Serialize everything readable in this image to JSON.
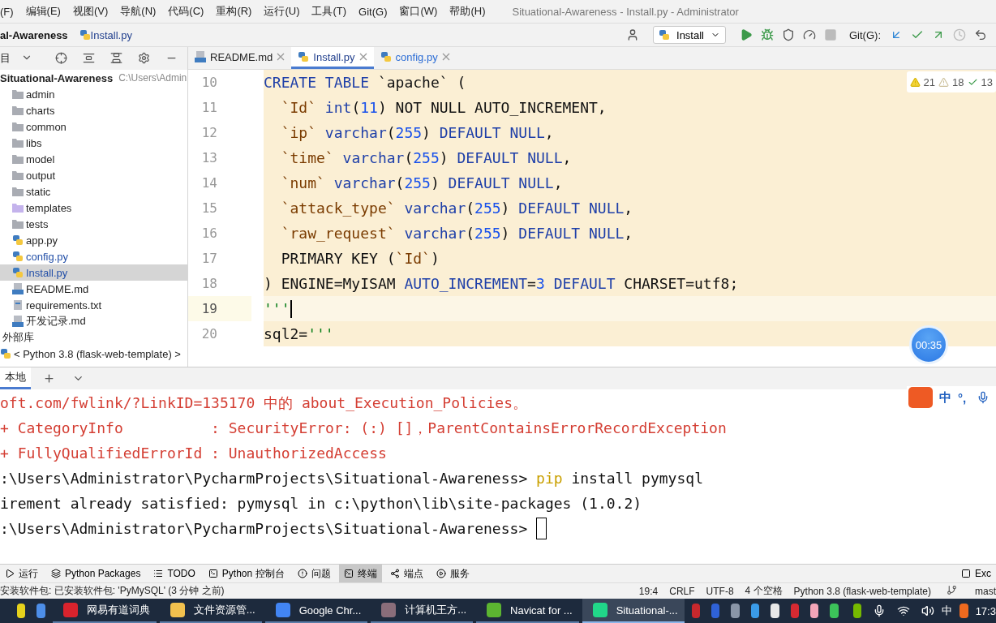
{
  "menu": [
    "(F)",
    "编辑(E)",
    "视图(V)",
    "导航(N)",
    "代码(C)",
    "重构(R)",
    "运行(U)",
    "工具(T)",
    "Git(G)",
    "窗口(W)",
    "帮助(H)"
  ],
  "window": {
    "title": "Situational-Awareness - Install.py - Administrator"
  },
  "breadcrumb": [
    "al-Awareness",
    "Install.py"
  ],
  "toolbar": {
    "run_config": "Install",
    "git_label": "Git(G):"
  },
  "project_panel": {
    "title": "目"
  },
  "tree": [
    {
      "label": "Situational-Awareness",
      "path": "C:\\Users\\Admin",
      "kind": "root",
      "selected": false,
      "children": [
        {
          "label": "admin",
          "kind": "folder",
          "selected": false,
          "modified": false
        },
        {
          "label": "charts",
          "kind": "folder",
          "selected": false,
          "modified": false
        },
        {
          "label": "common",
          "kind": "folder",
          "selected": false,
          "modified": false
        },
        {
          "label": "libs",
          "kind": "folder",
          "selected": false,
          "modified": false
        },
        {
          "label": "model",
          "kind": "folder",
          "selected": false,
          "modified": false
        },
        {
          "label": "output",
          "kind": "folder",
          "selected": false,
          "modified": false
        },
        {
          "label": "static",
          "kind": "folder",
          "selected": false,
          "modified": false
        },
        {
          "label": "templates",
          "kind": "template-folder",
          "selected": false,
          "modified": false
        },
        {
          "label": "tests",
          "kind": "folder",
          "selected": false,
          "modified": false
        },
        {
          "label": "app.py",
          "kind": "python",
          "selected": false,
          "modified": false
        },
        {
          "label": "config.py",
          "kind": "python",
          "selected": false,
          "modified": true
        },
        {
          "label": "Install.py",
          "kind": "python",
          "selected": true,
          "modified": true
        },
        {
          "label": "README.md",
          "kind": "markdown",
          "selected": false,
          "modified": false
        },
        {
          "label": "requirements.txt",
          "kind": "text",
          "selected": false,
          "modified": false
        },
        {
          "label": "开发记录.md",
          "kind": "markdown",
          "selected": false,
          "modified": false
        }
      ]
    },
    {
      "label": "外部库",
      "kind": "library",
      "selected": false,
      "children": [
        {
          "label": "< Python 3.8 (flask-web-template) >",
          "kind": "python",
          "selected": false,
          "modified": false
        }
      ]
    }
  ],
  "editor_tabs": [
    {
      "label": "README.md",
      "kind": "markdown",
      "selected": false,
      "modified": false
    },
    {
      "label": "Install.py",
      "kind": "python",
      "selected": true,
      "modified": true
    },
    {
      "label": "config.py",
      "kind": "python",
      "selected": false,
      "modified": true
    }
  ],
  "inspections": {
    "errors": "21",
    "warnings": "18",
    "typos": "13"
  },
  "code": [
    {
      "number": "10",
      "current": false,
      "tokens": [
        {
          "text": "CREATE TABLE ",
          "kind": "keyword"
        },
        {
          "text": "`apache`",
          "kind": "plain"
        },
        {
          "text": " (",
          "kind": "plain"
        }
      ]
    },
    {
      "number": "11",
      "current": false,
      "tokens": [
        {
          "text": "  `Id` ",
          "kind": "ident"
        },
        {
          "text": "int",
          "kind": "keyword"
        },
        {
          "text": "(",
          "kind": "plain"
        },
        {
          "text": "11",
          "kind": "number"
        },
        {
          "text": ") NOT NULL AUTO_INCREMENT,",
          "kind": "plain"
        }
      ]
    },
    {
      "number": "12",
      "current": false,
      "tokens": [
        {
          "text": "  `ip` ",
          "kind": "ident"
        },
        {
          "text": "varchar",
          "kind": "keyword"
        },
        {
          "text": "(",
          "kind": "plain"
        },
        {
          "text": "255",
          "kind": "number"
        },
        {
          "text": ") ",
          "kind": "plain"
        },
        {
          "text": "DEFAULT NULL",
          "kind": "keyword"
        },
        {
          "text": ",",
          "kind": "plain"
        }
      ]
    },
    {
      "number": "13",
      "current": false,
      "tokens": [
        {
          "text": "  `time` ",
          "kind": "ident"
        },
        {
          "text": "varchar",
          "kind": "keyword"
        },
        {
          "text": "(",
          "kind": "plain"
        },
        {
          "text": "255",
          "kind": "number"
        },
        {
          "text": ") ",
          "kind": "plain"
        },
        {
          "text": "DEFAULT NULL",
          "kind": "keyword"
        },
        {
          "text": ",",
          "kind": "plain"
        }
      ]
    },
    {
      "number": "14",
      "current": false,
      "tokens": [
        {
          "text": "  `num` ",
          "kind": "ident"
        },
        {
          "text": "varchar",
          "kind": "keyword"
        },
        {
          "text": "(",
          "kind": "plain"
        },
        {
          "text": "255",
          "kind": "number"
        },
        {
          "text": ") ",
          "kind": "plain"
        },
        {
          "text": "DEFAULT NULL",
          "kind": "keyword"
        },
        {
          "text": ",",
          "kind": "plain"
        }
      ]
    },
    {
      "number": "15",
      "current": false,
      "tokens": [
        {
          "text": "  `attack_type` ",
          "kind": "ident"
        },
        {
          "text": "varchar",
          "kind": "keyword"
        },
        {
          "text": "(",
          "kind": "plain"
        },
        {
          "text": "255",
          "kind": "number"
        },
        {
          "text": ") ",
          "kind": "plain"
        },
        {
          "text": "DEFAULT NULL",
          "kind": "keyword"
        },
        {
          "text": ",",
          "kind": "plain"
        }
      ]
    },
    {
      "number": "16",
      "current": false,
      "tokens": [
        {
          "text": "  `raw_request` ",
          "kind": "ident"
        },
        {
          "text": "varchar",
          "kind": "keyword"
        },
        {
          "text": "(",
          "kind": "plain"
        },
        {
          "text": "255",
          "kind": "number"
        },
        {
          "text": ") ",
          "kind": "plain"
        },
        {
          "text": "DEFAULT NULL",
          "kind": "keyword"
        },
        {
          "text": ",",
          "kind": "plain"
        }
      ]
    },
    {
      "number": "17",
      "current": false,
      "tokens": [
        {
          "text": "  PRIMARY KEY (",
          "kind": "plain"
        },
        {
          "text": "`Id`",
          "kind": "ident"
        },
        {
          "text": ")",
          "kind": "plain"
        }
      ]
    },
    {
      "number": "18",
      "current": false,
      "tokens": [
        {
          "text": ") ENGINE=MyISAM ",
          "kind": "plain"
        },
        {
          "text": "AUTO_INCREMENT",
          "kind": "keyword"
        },
        {
          "text": "=",
          "kind": "plain"
        },
        {
          "text": "3",
          "kind": "number"
        },
        {
          "text": " DEFAULT",
          "kind": "keyword"
        },
        {
          "text": " CHARSET=utf8;",
          "kind": "plain"
        }
      ]
    },
    {
      "number": "19",
      "current": true,
      "tokens": [
        {
          "text": "'''",
          "kind": "string"
        }
      ]
    },
    {
      "number": "20",
      "current": false,
      "tokens": [
        {
          "text": "sql2=",
          "kind": "plain"
        },
        {
          "text": "'''",
          "kind": "string"
        }
      ]
    }
  ],
  "timer": "00:35",
  "terminal": {
    "tabs": [
      {
        "label": "本地",
        "selected": true
      }
    ],
    "lines": [
      {
        "tokens": [
          {
            "text": "oft.com/fwlink/?LinkID=135170 中的 about_Execution_Policies。",
            "kind": "error"
          }
        ],
        "cursor": false
      },
      {
        "tokens": [
          {
            "text": "+ CategoryInfo          : SecurityError: (:) []，ParentContainsErrorRecordException",
            "kind": "error"
          }
        ],
        "cursor": false
      },
      {
        "tokens": [
          {
            "text": "+ FullyQualifiedErrorId : UnauthorizedAccess",
            "kind": "error"
          }
        ],
        "cursor": false
      },
      {
        "tokens": [
          {
            "text": ":\\Users\\Administrator\\PycharmProjects\\Situational-Awareness> ",
            "kind": "plain"
          },
          {
            "text": "pip",
            "kind": "command"
          },
          {
            "text": " install pymysql",
            "kind": "plain"
          }
        ],
        "cursor": false
      },
      {
        "tokens": [
          {
            "text": "irement already satisfied: pymysql in c:\\python\\lib\\site-packages (1.0.2)",
            "kind": "plain"
          }
        ],
        "cursor": false
      },
      {
        "tokens": [
          {
            "text": ":\\Users\\Administrator\\PycharmProjects\\Situational-Awareness> ",
            "kind": "plain"
          }
        ],
        "cursor": true
      }
    ]
  },
  "ime": {
    "mode": "中",
    "punct": "°,"
  },
  "tool_windows": [
    {
      "label": "运行",
      "kind": "run",
      "selected": false
    },
    {
      "label": "Python Packages",
      "kind": "packages",
      "selected": false
    },
    {
      "label": "TODO",
      "kind": "todo",
      "selected": false
    },
    {
      "label": "Python 控制台",
      "kind": "console",
      "selected": false
    },
    {
      "label": "问题",
      "kind": "problems",
      "selected": false
    },
    {
      "label": "终端",
      "kind": "terminal",
      "selected": true
    },
    {
      "label": "端点",
      "kind": "endpoints",
      "selected": false
    },
    {
      "label": "服务",
      "kind": "services",
      "selected": false
    }
  ],
  "tool_windows_right": "Exc",
  "status_bar": {
    "message": "安装软件包: 已安装软件包: 'PyMySQL' (3 分钟 之前)",
    "items": [
      "19:4",
      "CRLF",
      "UTF-8",
      "4 个空格",
      "Python 3.8 (flask-web-template)"
    ],
    "branch": "mast"
  },
  "taskbar": {
    "apps": [
      {
        "label": "网易有道词典",
        "color": "#d9232d",
        "selected": false
      },
      {
        "label": "文件资源管...",
        "color": "#f2c14e",
        "selected": false
      },
      {
        "label": "Google Chr...",
        "color": "#4285f4",
        "selected": false
      },
      {
        "label": "计算机王方...",
        "color": "#8a6d7a",
        "selected": false
      },
      {
        "label": "Navicat for ...",
        "color": "#5cb531",
        "selected": false
      },
      {
        "label": "Situational-...",
        "color": "#21d789",
        "selected": true
      }
    ],
    "tray_lang": "中",
    "clock": "17:3"
  }
}
